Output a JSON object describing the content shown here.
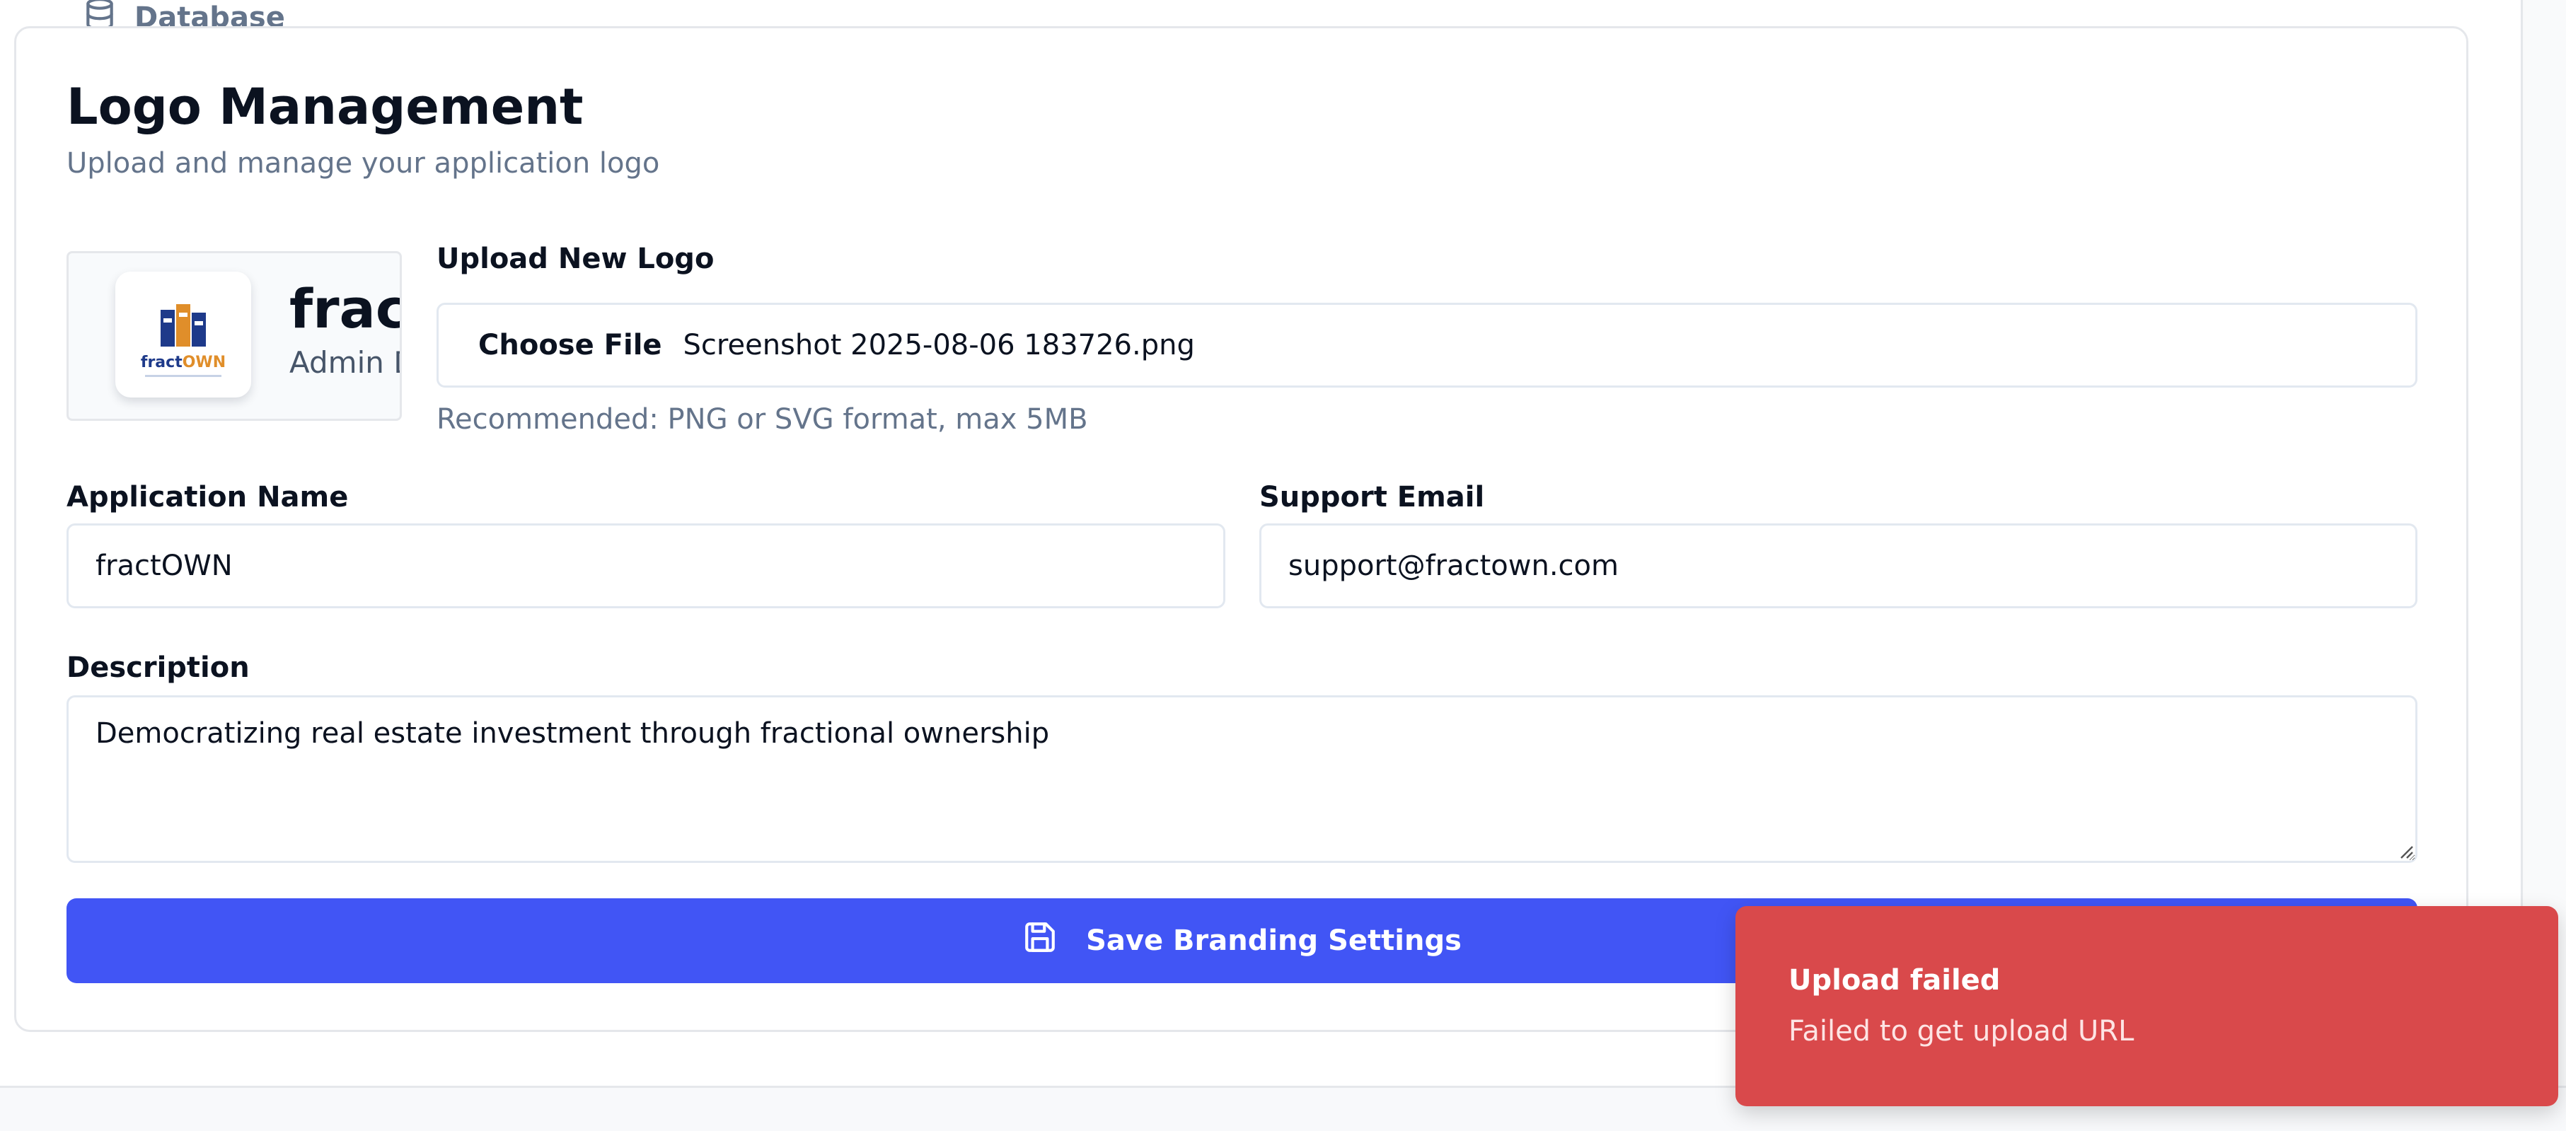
{
  "tab": {
    "label": "Database",
    "icon": "database-icon"
  },
  "section": {
    "title": "Logo Management",
    "subtitle": "Upload and manage your application logo"
  },
  "logo_preview": {
    "brand_prefix": "fract",
    "brand_suffix": "OWN",
    "preview_name": "fract",
    "preview_subtitle": "Admin D"
  },
  "upload": {
    "label": "Upload New Logo",
    "choose_label": "Choose File",
    "file_name": "Screenshot 2025-08-06 183726.png",
    "hint": "Recommended: PNG or SVG format, max 5MB"
  },
  "fields": {
    "app_name_label": "Application Name",
    "app_name_value": "fractOWN",
    "support_email_label": "Support Email",
    "support_email_value": "support@fractown.com",
    "description_label": "Description",
    "description_value": "Democratizing real estate investment through fractional ownership"
  },
  "save_button": {
    "label": "Save Branding Settings",
    "icon": "save-icon"
  },
  "toast": {
    "title": "Upload failed",
    "message": "Failed to get upload URL",
    "color": "#d9494b"
  },
  "colors": {
    "primary": "#4155f5",
    "brand_blue": "#1e3a8a",
    "brand_orange": "#e08e2a",
    "muted_text": "#64748b"
  }
}
